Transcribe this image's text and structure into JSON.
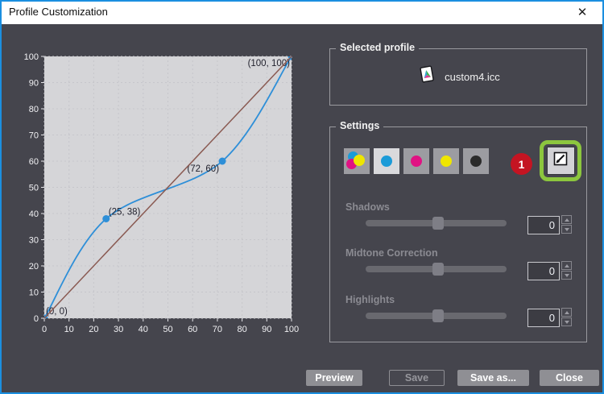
{
  "window": {
    "title": "Profile Customization",
    "close_glyph": "✕"
  },
  "chart_data": {
    "type": "line",
    "title": "",
    "xlabel": "",
    "ylabel": "",
    "xlim": [
      0,
      100
    ],
    "ylim": [
      0,
      100
    ],
    "grid": true,
    "x_ticks": [
      0,
      10,
      20,
      30,
      40,
      50,
      60,
      70,
      80,
      90,
      100
    ],
    "y_ticks": [
      0,
      10,
      20,
      30,
      40,
      50,
      60,
      70,
      80,
      90,
      100
    ],
    "plot_bg": "#d5d5d8",
    "grid_color": "#c6c6cb",
    "tick_color": "#e8e8ec",
    "axis_label_color": "#f1f1f4",
    "point_label_color": "#22222e",
    "series": [
      {
        "name": "tone-curve",
        "type": "spline",
        "color": "#2e8fd8",
        "markers": true,
        "points": [
          {
            "x": 0,
            "y": 0,
            "label": "(0, 0)",
            "label_dx": 2,
            "label_dy": -5,
            "anchor": "start"
          },
          {
            "x": 25,
            "y": 38,
            "label": "(25, 38)",
            "label_dx": 3,
            "label_dy": -5,
            "anchor": "start"
          },
          {
            "x": 72,
            "y": 60,
            "label": "(72, 60)",
            "label_dx": -4,
            "label_dy": 13,
            "anchor": "end"
          },
          {
            "x": 100,
            "y": 100,
            "label": "(100, 100)",
            "label_dx": -2,
            "label_dy": 12,
            "anchor": "end"
          }
        ]
      },
      {
        "name": "reference-diagonal",
        "type": "line",
        "color": "#8a5a52",
        "markers": false,
        "points": [
          {
            "x": 0,
            "y": 0
          },
          {
            "x": 100,
            "y": 100
          }
        ]
      }
    ]
  },
  "selected_profile": {
    "label": "Selected profile",
    "file_name": "custom4.icc",
    "icon": "icc-profile-icon"
  },
  "settings": {
    "label": "Settings",
    "annotation_badge": "1",
    "colors": {
      "cyan": "#1b9bd8",
      "magenta": "#e01283",
      "yellow": "#efe600",
      "black": "#2b2b2b",
      "badge_red": "#c41422",
      "highlight_green": "#8cc63e"
    },
    "channel_buttons": [
      {
        "name": "all-channels",
        "selected": false
      },
      {
        "name": "cyan-channel",
        "selected": true
      },
      {
        "name": "magenta-channel",
        "selected": false
      },
      {
        "name": "yellow-channel",
        "selected": false
      },
      {
        "name": "black-channel",
        "selected": false
      }
    ],
    "sliders": [
      {
        "label": "Shadows",
        "value": "0"
      },
      {
        "label": "Midtone Correction",
        "value": "0"
      },
      {
        "label": "Highlights",
        "value": "0"
      }
    ]
  },
  "footer": {
    "buttons": [
      {
        "label": "Preview",
        "enabled": true
      },
      {
        "label": "Save",
        "enabled": false
      },
      {
        "label": "Save as...",
        "enabled": true
      },
      {
        "label": "Close",
        "enabled": true
      }
    ]
  }
}
